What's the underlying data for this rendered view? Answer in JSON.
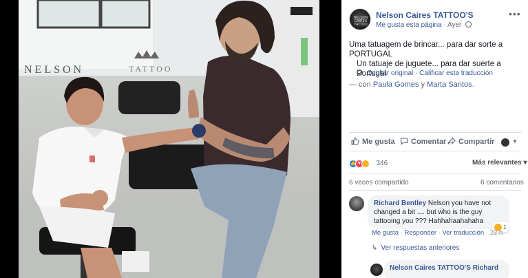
{
  "post": {
    "page_name": "Nelson Caires TATTOO'S",
    "avatar_text": "NELSON CAIRES TATTOO",
    "like_page": "Me gusta esta página",
    "separator": "·",
    "time": "Ayer",
    "more": "•••",
    "text": "Uma tatuagem de brincar... para dar sorte a PORTUGAL",
    "translation": "Un tatuaje de juguete... para dar suerte a Portugal",
    "show_original": "Ocultar original",
    "rate_translation": "Calificar esta traducción",
    "with_prefix": "— con",
    "tagged": [
      "Paula Gomes",
      "Marta Santos"
    ],
    "tagged_joiner": "y",
    "tagged_suffix": "."
  },
  "actions": {
    "like": "Me gusta",
    "comment": "Comentar",
    "share": "Compartir"
  },
  "stats": {
    "reaction_count": "346",
    "sort": "Más relevantes",
    "shares": "6 veces compartido",
    "comments": "6 comentarios"
  },
  "comment": {
    "author": "Richard Bentley",
    "text": "Nelson you have not changed a bit .... but who is the guy tattooing you ??? Hahhahaahahaha",
    "reaction_count": "1",
    "like": "Me gusta",
    "reply": "Responder",
    "see_translation": "Ver traducción",
    "time": "22 h",
    "dot": "·",
    "previous_replies": "Ver respuestas anteriores"
  },
  "reply": {
    "author": "Nelson Caires TATTOO'S",
    "text_start": "Richard"
  },
  "photo": {
    "wall_text_left": "NELSON",
    "wall_text_right": "TATTOO"
  },
  "colors": {
    "link": "#385898",
    "secondary_text": "#606770",
    "like_blue": "#1877f2",
    "love_red": "#f33e58",
    "haha_yellow": "#f7b125"
  }
}
